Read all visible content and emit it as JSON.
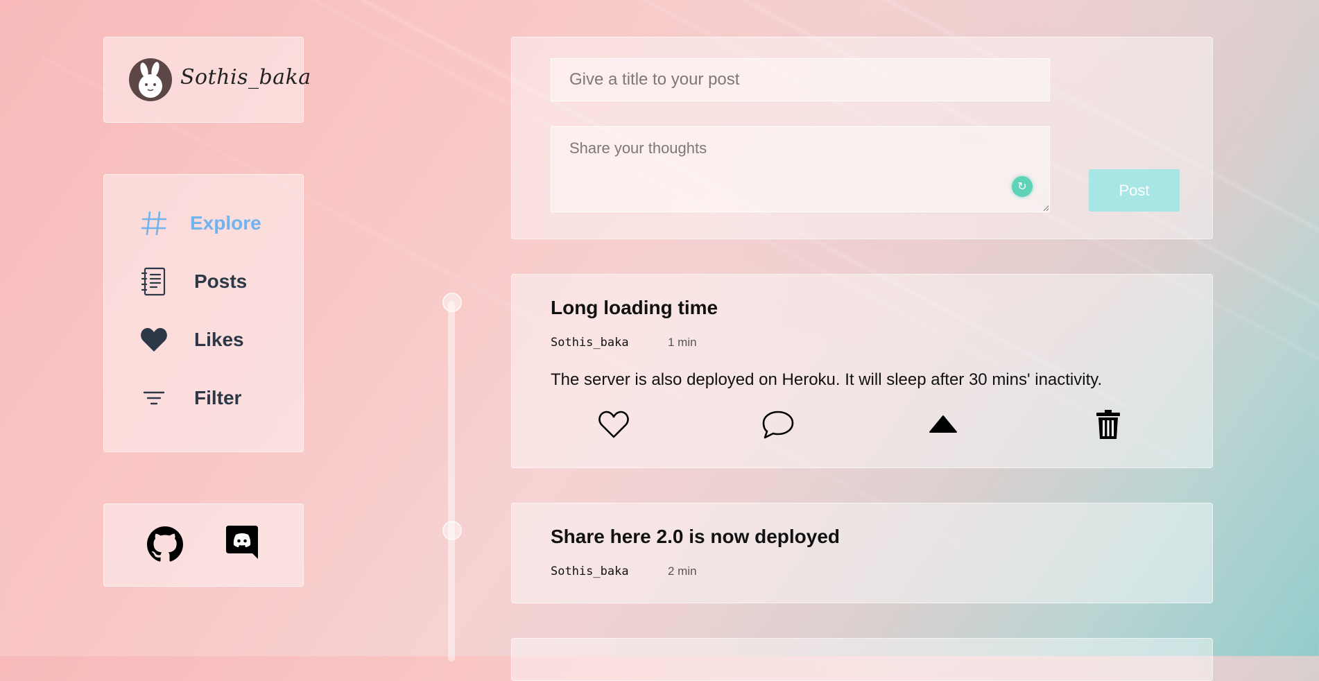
{
  "profile": {
    "username": "Sothis_baka"
  },
  "nav": {
    "items": [
      {
        "label": "Explore",
        "icon": "hash-icon",
        "active": true
      },
      {
        "label": "Posts",
        "icon": "notebook-icon"
      },
      {
        "label": "Likes",
        "icon": "heart-icon"
      },
      {
        "label": "Filter",
        "icon": "filter-icon"
      }
    ]
  },
  "social": {
    "links": [
      "github-icon",
      "discord-icon"
    ]
  },
  "composer": {
    "title_placeholder": "Give a title to your post",
    "body_placeholder": "Share your thoughts",
    "post_label": "Post"
  },
  "posts": [
    {
      "title": "Long loading time",
      "author": "Sothis_baka",
      "time": "1 min",
      "body": "The server is also deployed on Heroku. It will sleep after 30 mins' inactivity."
    },
    {
      "title": "Share here 2.0 is now deployed",
      "author": "Sothis_baka",
      "time": "2 min"
    }
  ],
  "colors": {
    "accent": "#6fb3ef",
    "post_button": "#a8e6e6",
    "nav_text": "#2c3747"
  }
}
